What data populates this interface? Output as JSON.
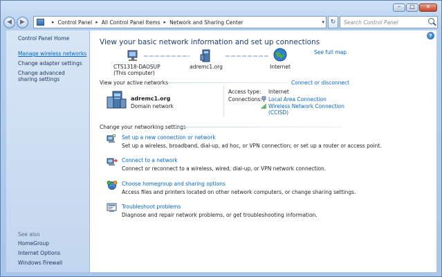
{
  "window": {
    "minimize_glyph": "–",
    "maximize_glyph": "□",
    "close_glyph": "✕"
  },
  "nav": {
    "back_glyph": "◀",
    "forward_glyph": "▶",
    "breadcrumbs": [
      "Control Panel",
      "All Control Panel Items",
      "Network and Sharing Center"
    ],
    "separator": "▸",
    "dropdown_glyph": "▾",
    "refresh_glyph": "↻",
    "search_placeholder": "Search Control Panel"
  },
  "sidebar": {
    "home": "Control Panel Home",
    "links": [
      "Manage wireless networks",
      "Change adapter settings",
      "Change advanced sharing settings"
    ],
    "see_also_title": "See also",
    "see_also": [
      "HomeGroup",
      "Internet Options",
      "Windows Firewall"
    ]
  },
  "main": {
    "help_glyph": "?",
    "heading": "View your basic network information and set up connections",
    "see_full_map": "See full map",
    "map": {
      "computer_name": "CTS1318-DAOSUP",
      "computer_sub": "(This computer)",
      "network_name": "adremc1.org",
      "internet": "Internet"
    },
    "active_title": "View your active networks",
    "connect_disconnect": "Connect or disconnect",
    "active_network": {
      "name": "adremc1.org",
      "type": "Domain network",
      "access_type_label": "Access type:",
      "access_type": "Internet",
      "connections_label": "Connections:",
      "connections": [
        "Local Area Connection",
        "Wireless Network Connection",
        "(CCISD)"
      ]
    },
    "settings_title": "Change your networking settings",
    "tasks": [
      {
        "link": "Set up a new connection or network",
        "desc": "Set up a wireless, broadband, dial-up, ad hoc, or VPN connection; or set up a router or access point."
      },
      {
        "link": "Connect to a network",
        "desc": "Connect or reconnect to a wireless, wired, dial-up, or VPN network connection."
      },
      {
        "link": "Choose homegroup and sharing options",
        "desc": "Access files and printers located on other network computers, or change sharing settings."
      },
      {
        "link": "Troubleshoot problems",
        "desc": "Diagnose and repair network problems, or get troubleshooting information."
      }
    ]
  },
  "colors": {
    "link": "#0066cc",
    "heading": "#1e3b6e",
    "sidebar_bg": "#c2d6ef"
  }
}
